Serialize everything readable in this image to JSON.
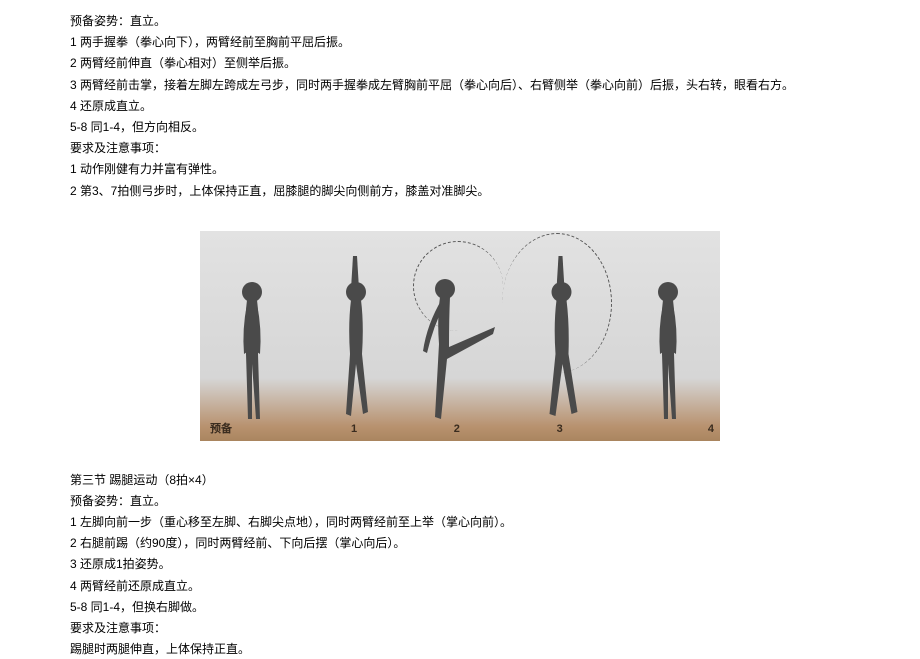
{
  "section2": {
    "prep": "预备姿势：直立。",
    "step1": "1 两手握拳（拳心向下），两臂经前至胸前平屈后振。",
    "step2": "2 两臂经前伸直（拳心相对）至侧举后振。",
    "step3": "3 两臂经前击掌，接着左脚左跨成左弓步，同时两手握拳成左臂胸前平屈（拳心向后）、右臂侧举（拳心向前）后振，头右转，眼看右方。",
    "step4": "4 还原成直立。",
    "step58": "5-8 同1-4，但方向相反。",
    "reqTitle": "要求及注意事项：",
    "req1": "1 动作刚健有力并富有弹性。",
    "req2": "2 第3、7拍侧弓步时，上体保持正直，屈膝腿的脚尖向侧前方，膝盖对准脚尖。"
  },
  "figure": {
    "labels": [
      "预备",
      "1",
      "2",
      "3",
      "4"
    ]
  },
  "section3": {
    "title": "第三节 踢腿运动（8拍×4）",
    "prep": "预备姿势：直立。",
    "step1": "1 左脚向前一步（重心移至左脚、右脚尖点地），同时两臂经前至上举（掌心向前）。",
    "step2": "2 右腿前踢（约90度），同时两臂经前、下向后摆（掌心向后）。",
    "step3": "3 还原成1拍姿势。",
    "step4": "4 两臂经前还原成直立。",
    "step58": "5-8 同1-4，但换右脚做。",
    "reqTitle": "要求及注意事项：",
    "req1": "踢腿时两腿伸直，上体保持正直。"
  }
}
